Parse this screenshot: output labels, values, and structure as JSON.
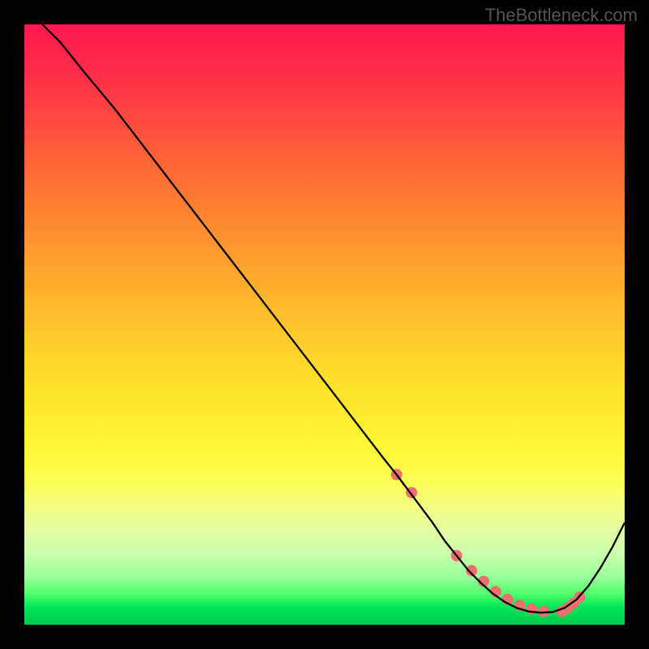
{
  "watermark": "TheBottleneck.com",
  "chart_data": {
    "type": "line",
    "title": "",
    "xlabel": "",
    "ylabel": "",
    "xlim": [
      0,
      100
    ],
    "ylim": [
      0,
      100
    ],
    "background": "rainbow-gradient-vertical",
    "series": [
      {
        "name": "bottleneck-curve",
        "color": "#000000",
        "x": [
          3,
          6,
          10,
          15,
          20,
          25,
          30,
          35,
          40,
          45,
          50,
          55,
          60,
          62,
          65,
          68,
          70,
          72,
          74,
          76,
          78,
          80,
          82,
          84,
          86,
          88,
          90,
          92,
          94,
          96,
          98,
          100
        ],
        "values": [
          100,
          97,
          92,
          86,
          79.5,
          73,
          66.5,
          60,
          53.5,
          47,
          40.5,
          34,
          27.5,
          25,
          21,
          17,
          14,
          11.5,
          9,
          7,
          5.2,
          3.8,
          2.8,
          2.2,
          2,
          2.1,
          2.8,
          4.2,
          6.5,
          9.5,
          13,
          17
        ]
      }
    ],
    "markers": {
      "name": "highlight-dots",
      "color": "#ef6f6f",
      "radius_px": 7,
      "x": [
        62,
        64.5,
        72,
        74.5,
        76.5,
        78.5,
        80.5,
        82.5,
        84.5,
        86.5,
        89.5,
        90.5,
        91.5,
        92.5
      ],
      "values": [
        25,
        22,
        11.5,
        9,
        7.2,
        5.5,
        4.2,
        3.2,
        2.6,
        2.2,
        2.2,
        2.8,
        3.6,
        4.6
      ]
    }
  }
}
